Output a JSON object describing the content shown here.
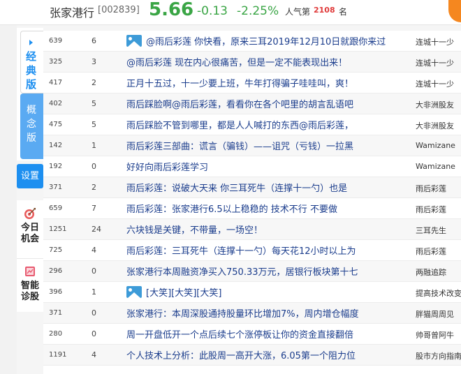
{
  "header": {
    "stock_name": "张家港行",
    "stock_code": "[002839]",
    "price": "5.66",
    "change": "-0.13",
    "change_pct": "-2.25%",
    "popularity_label": "人气第",
    "popularity_rank": "2108",
    "popularity_unit": "名",
    "price_color": "#3aa545"
  },
  "sidebar": {
    "classic_tab": "经典版",
    "concept_tab": "概念版",
    "settings": "设置",
    "today_chance": "今日机会",
    "smart_diagnosis": "智能诊股",
    "accent_color": "#1d8ff0"
  },
  "posts": [
    {
      "reads": "639",
      "replies": "6",
      "has_image": true,
      "title": "@雨后彩莲 你快看，原来三耳2019年12月10日就跟你来过",
      "author": "连城十一少"
    },
    {
      "reads": "325",
      "replies": "3",
      "has_image": false,
      "title": "@雨后彩莲 现在内心很痛苦，但是一定不能表现出来！",
      "author": "连城十一少"
    },
    {
      "reads": "417",
      "replies": "2",
      "has_image": false,
      "title": "正月十五过，十一少要上班，牛年打得骗子哇哇叫，爽！",
      "author": "连城十一少"
    },
    {
      "reads": "402",
      "replies": "5",
      "has_image": false,
      "title": "雨后踩脸啊@雨后彩莲，看看你在各个吧里的胡言乱语吧",
      "author": "大非洲股友"
    },
    {
      "reads": "475",
      "replies": "5",
      "has_image": false,
      "title": "雨后踩脸不管到哪里，都是人人喊打的东西@雨后彩莲，",
      "author": "大非洲股友"
    },
    {
      "reads": "142",
      "replies": "1",
      "has_image": false,
      "title": "雨后彩莲三部曲：谎言（骗钱）——诅咒（亏钱）一拉黑",
      "author": "Wamizane"
    },
    {
      "reads": "192",
      "replies": "0",
      "has_image": false,
      "title": "好好向雨后彩莲学习",
      "author": "Wamizane"
    },
    {
      "reads": "371",
      "replies": "2",
      "has_image": false,
      "title": "雨后彩莲：说破大天来 你三耳死牛（连撑十一勺）也是",
      "author": "雨后彩莲"
    },
    {
      "reads": "659",
      "replies": "7",
      "has_image": false,
      "title": "雨后彩莲：张家港行6.5以上稳稳的 技术不行 不要做",
      "author": "雨后彩莲"
    },
    {
      "reads": "1251",
      "replies": "24",
      "has_image": false,
      "title": "六块钱是关键，不带量，一场空！",
      "author": "三耳先生"
    },
    {
      "reads": "725",
      "replies": "4",
      "has_image": false,
      "title": "雨后彩莲：三耳死牛（连撑十一勺）每天花12小时以上为",
      "author": "雨后彩莲"
    },
    {
      "reads": "296",
      "replies": "0",
      "has_image": false,
      "title": "张家港行本周融资净买入750.33万元，居银行板块第十七",
      "author": "两融追踪"
    },
    {
      "reads": "396",
      "replies": "1",
      "has_image": true,
      "title": "[大笑][大笑][大笑]",
      "author": "提高技术改变"
    },
    {
      "reads": "371",
      "replies": "0",
      "has_image": false,
      "title": "张家港行：本周深股通持股量环比增加7%，周内增仓幅度",
      "author": "胖猫周周见"
    },
    {
      "reads": "280",
      "replies": "0",
      "has_image": false,
      "title": "周一开盘低开一个点后续七个涨停板让你的资金直接翻倍",
      "author": "帅哥曾阿牛"
    },
    {
      "reads": "1191",
      "replies": "4",
      "has_image": false,
      "title": "个人技术上分析：此股周一高开大涨，6.05第一个阻力位",
      "author": "股市方向指南"
    },
    {
      "reads": "",
      "replies": "",
      "has_image": false,
      "title": "",
      "author": ""
    }
  ]
}
